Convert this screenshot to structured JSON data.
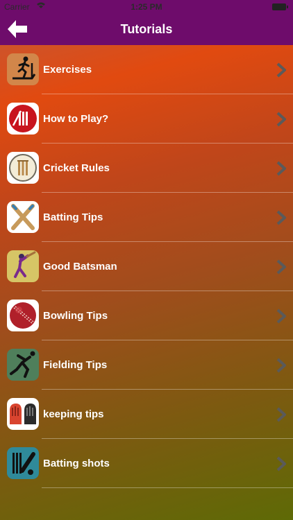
{
  "status_bar": {
    "carrier": "Carrier",
    "time": "1:25 PM"
  },
  "nav": {
    "title": "Tutorials",
    "back_icon": "arrow-left-icon"
  },
  "colors": {
    "nav_background": "#6e0c6b",
    "label_text": "#ffffff",
    "chevron": "#5a5a5a"
  },
  "tutorials": [
    {
      "label": "Exercises",
      "icon": "treadmill-icon"
    },
    {
      "label": "How to Play?",
      "icon": "cricket-logo-icon"
    },
    {
      "label": "Cricket Rules",
      "icon": "stumps-icon"
    },
    {
      "label": "Batting Tips",
      "icon": "crossed-bats-icon"
    },
    {
      "label": "Good Batsman",
      "icon": "batsman-icon"
    },
    {
      "label": "Bowling Tips",
      "icon": "cricket-ball-icon"
    },
    {
      "label": "Fielding Tips",
      "icon": "fielder-icon"
    },
    {
      "label": "keeping tips",
      "icon": "keeping-gloves-icon"
    },
    {
      "label": "Batting shots",
      "icon": "batting-shot-icon"
    }
  ]
}
